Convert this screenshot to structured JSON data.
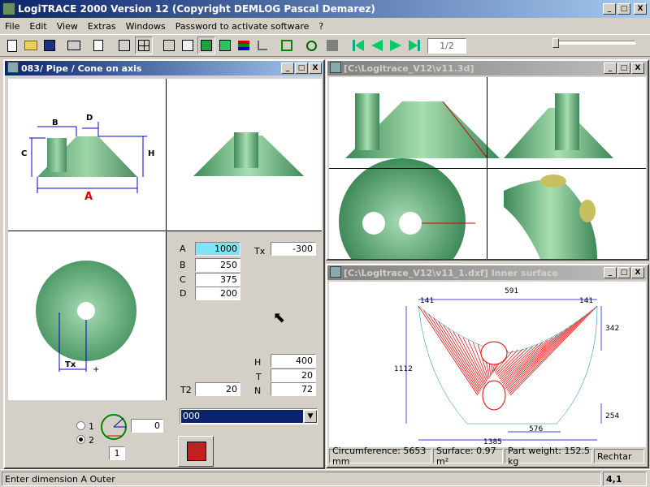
{
  "app": {
    "title": "LogiTRACE 2000  Version 12  (Copyright DEMLOG Pascal Demarez)"
  },
  "window_buttons": {
    "minimize": "_",
    "maximize": "□",
    "close": "X"
  },
  "menu": [
    "File",
    "Edit",
    "View",
    "Extras",
    "Windows",
    "Password to activate software",
    "?"
  ],
  "toolbar": {
    "icons": [
      "new-icon",
      "open-icon",
      "save-icon",
      "print-icon",
      "copy-icon",
      "single-view-icon",
      "four-views-icon",
      "wireframe-icon",
      "box-icon",
      "solid-icon",
      "shaded-icon",
      "layers-icon",
      "tree-icon",
      "frame-icon",
      "curve-icon",
      "gray-icon",
      "first-icon",
      "prev-icon",
      "next-icon",
      "last-icon"
    ],
    "page": "1/2"
  },
  "win1": {
    "title": "083/ Pipe / Cone on axis",
    "diagram": {
      "A": "A",
      "B": "B",
      "C": "C",
      "D": "D",
      "H": "H",
      "Tx": "Tx",
      "plus": "+"
    },
    "fields": {
      "A": {
        "label": "A",
        "value": "1000"
      },
      "B": {
        "label": "B",
        "value": "250"
      },
      "C": {
        "label": "C",
        "value": "375"
      },
      "D": {
        "label": "D",
        "value": "200"
      },
      "Tx": {
        "label": "Tx",
        "value": "-300"
      },
      "H": {
        "label": "H",
        "value": "400"
      },
      "T": {
        "label": "T",
        "value": "20"
      },
      "N": {
        "label": "N",
        "value": "72"
      },
      "T2": {
        "label": "T2",
        "value": "20"
      }
    },
    "radio1": "1",
    "radio2": "2",
    "angle_value": "0",
    "count_value": "1",
    "combo_value": "000"
  },
  "win2": {
    "title": "[C:\\Logitrace_V12\\v11.3d]"
  },
  "win3": {
    "title": "[C:\\Logitrace_V12\\v11_1.dxf]  Inner surface",
    "dims": {
      "d141a": "141",
      "d591": "591",
      "d141b": "141",
      "d342": "342",
      "d1112": "1112",
      "d254": "254",
      "d576": "576",
      "d1385": "1385"
    },
    "status": {
      "circumference": "Circumference: 5653 mm",
      "surface": "Surface: 0.97 m²",
      "weight": "Part weight: 152.5 kg",
      "extra": "Rechtar"
    }
  },
  "status": {
    "message": "Enter dimension A Outer",
    "coords": "4,1"
  }
}
